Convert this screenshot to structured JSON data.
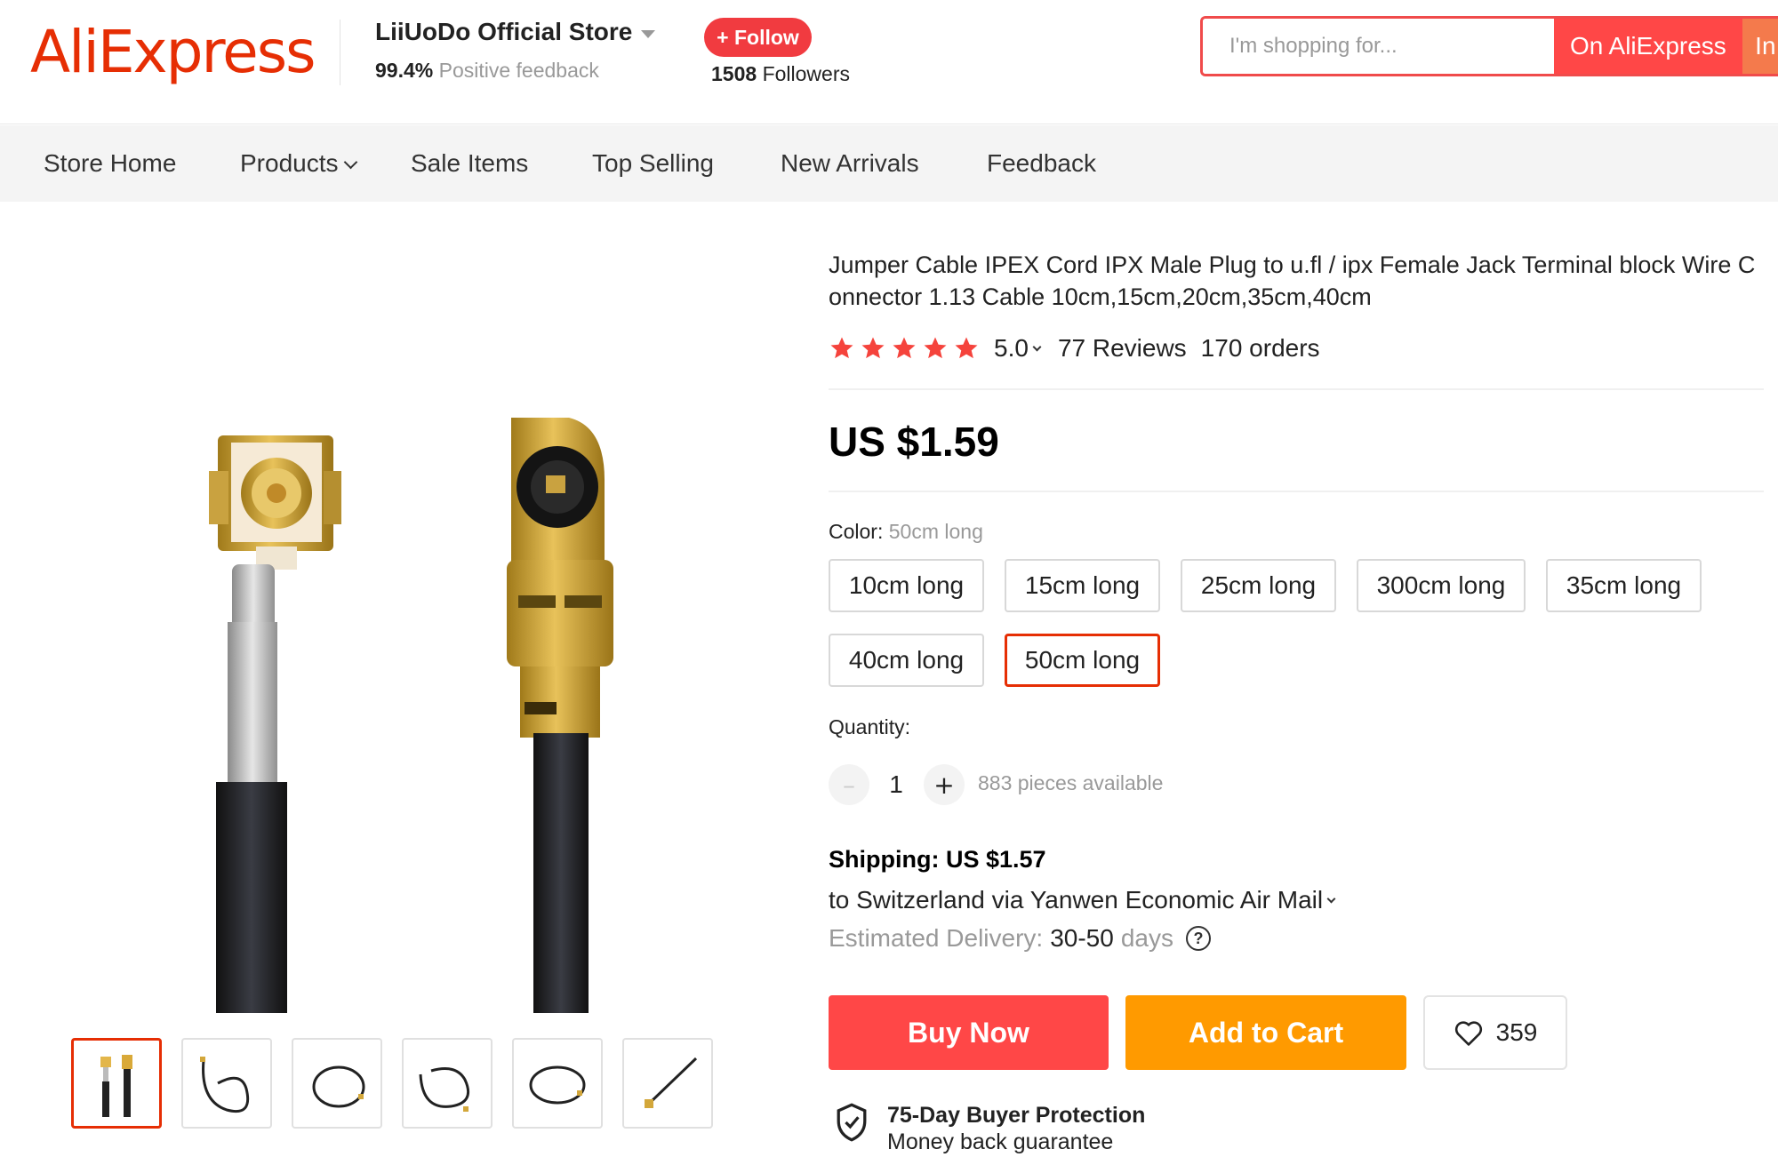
{
  "header": {
    "logo": "AliExpress",
    "store_name": "LiiUoDo Official Store",
    "feedback_percent": "99.4%",
    "feedback_label": "Positive feedback",
    "follow_label": "+ Follow",
    "followers_count": "1508",
    "followers_label": "Followers",
    "search": {
      "placeholder": "I'm shopping for...",
      "on_aliexpress_label": "On AliExpress",
      "in_store_label": "In this store"
    }
  },
  "nav": {
    "items": [
      "Store Home",
      "Products",
      "Sale Items",
      "Top Selling",
      "New Arrivals",
      "Feedback"
    ]
  },
  "product": {
    "title": "Jumper Cable IPEX Cord IPX Male Plug to u.fl / ipx Female Jack Terminal block Wire Connector 1.13 Cable 10cm,15cm,20cm,35cm,40cm",
    "rating": "5.0",
    "stars": 5,
    "reviews": "77 Reviews",
    "orders": "170 orders",
    "price": "US $1.59",
    "color_label": "Color:",
    "color_selected": "50cm long",
    "options": [
      "10cm long",
      "15cm long",
      "25cm long",
      "300cm long",
      "35cm long",
      "40cm long",
      "50cm long"
    ],
    "quantity_label": "Quantity:",
    "quantity": "1",
    "quantity_minus": "–",
    "quantity_plus": "+",
    "available": "883 pieces available",
    "shipping_title": "Shipping: US $1.57",
    "shipping_dest": "to Switzerland via Yanwen Economic Air Mail",
    "delivery_label": "Estimated Delivery:",
    "delivery_value": "30-50",
    "delivery_unit": "days",
    "help_icon_glyph": "?",
    "buy_now": "Buy Now",
    "add_to_cart": "Add to Cart",
    "wishlist_count": "359",
    "protection_title": "75-Day Buyer Protection",
    "protection_sub": "Money back guarantee"
  },
  "gallery": {
    "thumbnail_count": 6,
    "active_index": 0
  },
  "colors": {
    "brand": "#e62e04",
    "buy": "#ff4747",
    "cart": "#ff9a00",
    "star": "#f5433c"
  }
}
